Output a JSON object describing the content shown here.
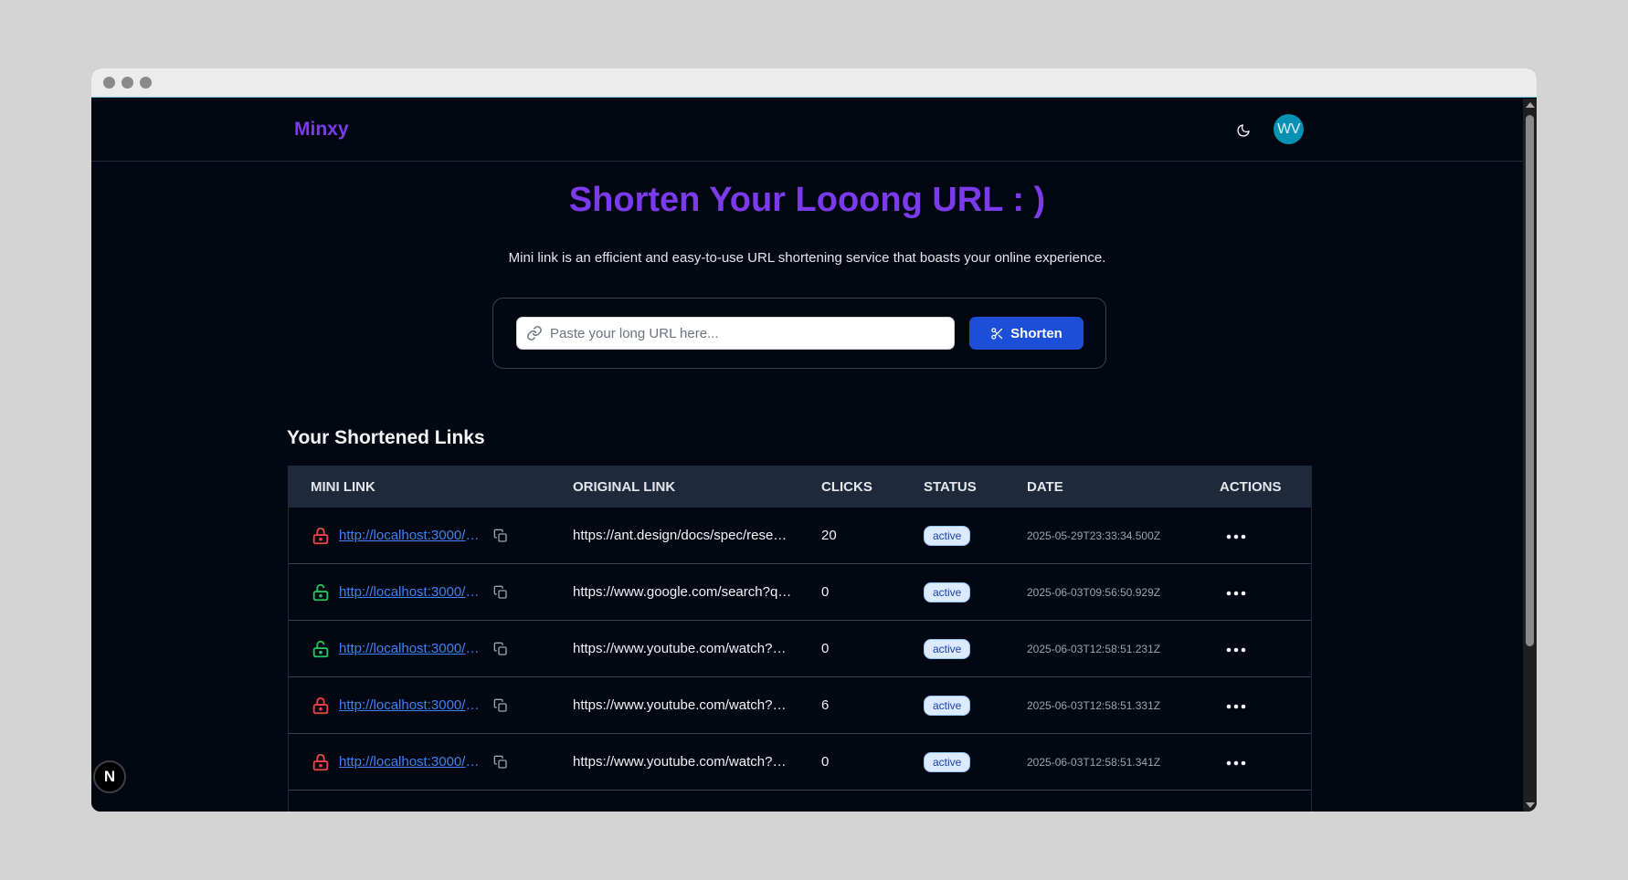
{
  "brand": "Minxy",
  "user": {
    "initials": "WV"
  },
  "hero": {
    "title": "Shorten Your Looong URL : )",
    "subtitle": "Mini link is an efficient and easy-to-use URL shortening service that boasts your online experience."
  },
  "shorten": {
    "placeholder": "Paste your long URL here...",
    "button_label": "Shorten"
  },
  "links_section": {
    "title": "Your Shortened Links",
    "columns": [
      "MINI LINK",
      "ORIGINAL LINK",
      "CLICKS",
      "STATUS",
      "DATE",
      "ACTIONS"
    ],
    "rows": [
      {
        "locked": true,
        "mini": "http://localhost:3000/6…",
        "original": "https://ant.design/docs/spec/rese…",
        "clicks": "20",
        "status": "active",
        "date": "2025-05-29T23:33:34.500Z"
      },
      {
        "locked": false,
        "mini": "http://localhost:3000/37…",
        "original": "https://www.google.com/search?q…",
        "clicks": "0",
        "status": "active",
        "date": "2025-06-03T09:56:50.929Z"
      },
      {
        "locked": false,
        "mini": "http://localhost:3000/W…",
        "original": "https://www.youtube.com/watch?…",
        "clicks": "0",
        "status": "active",
        "date": "2025-06-03T12:58:51.231Z"
      },
      {
        "locked": true,
        "mini": "http://localhost:3000/la…",
        "original": "https://www.youtube.com/watch?…",
        "clicks": "6",
        "status": "active",
        "date": "2025-06-03T12:58:51.331Z"
      },
      {
        "locked": true,
        "mini": "http://localhost:3000/th…",
        "original": "https://www.youtube.com/watch?…",
        "clicks": "0",
        "status": "active",
        "date": "2025-06-03T12:58:51.341Z"
      }
    ]
  },
  "colors": {
    "accent": "#7c3aed",
    "primary_button": "#1d4ed8",
    "locked": "#ef4444",
    "unlocked": "#22c55e",
    "background": "#030712"
  },
  "dev_badge": "N"
}
